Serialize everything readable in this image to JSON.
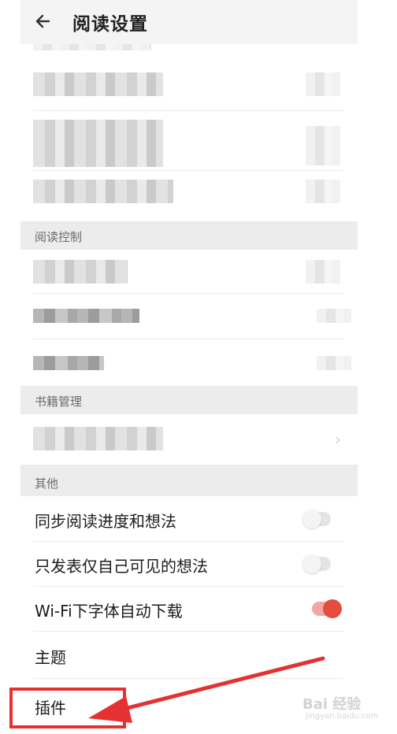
{
  "header": {
    "title": "阅读设置",
    "back_icon": "arrow-left-icon"
  },
  "sections": {
    "reading_control": {
      "label": "阅读控制"
    },
    "book_management": {
      "label": "书籍管理"
    },
    "other": {
      "label": "其他"
    }
  },
  "other_items": [
    {
      "label": "同步阅读进度和想法",
      "toggle": "off"
    },
    {
      "label": "只发表仅自己可见的想法",
      "toggle": "off"
    },
    {
      "label": "Wi-Fi下字体自动下载",
      "toggle": "on"
    },
    {
      "label": "主题"
    },
    {
      "label": "插件"
    }
  ],
  "watermark": {
    "brand": "Bai 经验",
    "sub": "jingyan.baidu.com"
  },
  "colors": {
    "accent": "#e54d42",
    "annotation": "#e43232",
    "panel_bg": "#f4f4f4",
    "section_bg": "#ececec"
  }
}
